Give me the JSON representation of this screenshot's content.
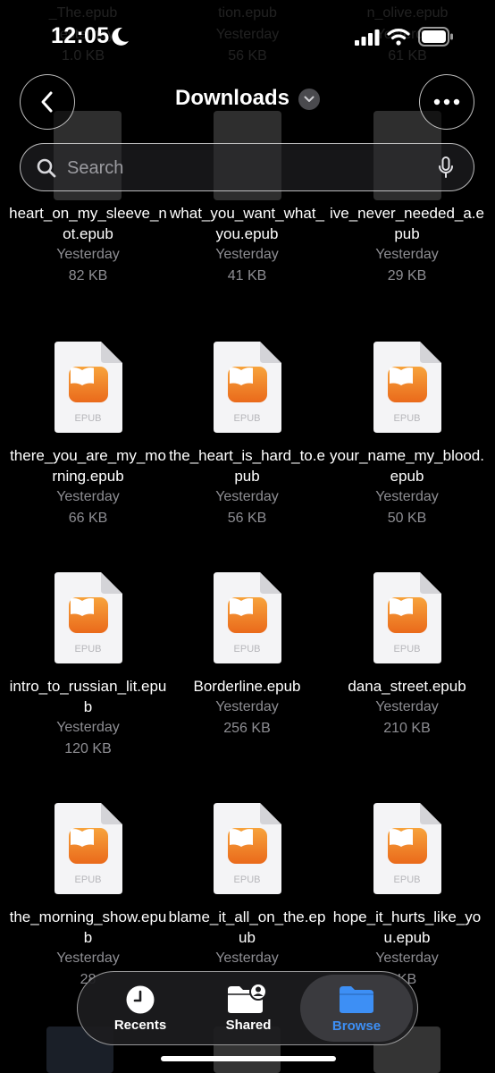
{
  "status_bar": {
    "time": "12:05"
  },
  "header": {
    "title": "Downloads"
  },
  "search": {
    "placeholder": "Search"
  },
  "ghost_items": [
    {
      "name": "_The.epub",
      "date": "Yesterday",
      "size": "1.0 KB"
    },
    {
      "name": "tion.epub",
      "date": "Yesterday",
      "size": "56 KB"
    },
    {
      "name": "n_olive.epub",
      "date": "Yesterday",
      "size": "61 KB"
    }
  ],
  "files": [
    {
      "name": "heart_on_my_sleeve_not.epub",
      "date": "Yesterday",
      "size": "82 KB"
    },
    {
      "name": "what_you_want_what_you.epub",
      "date": "Yesterday",
      "size": "41 KB"
    },
    {
      "name": "ive_never_needed_a.epub",
      "date": "Yesterday",
      "size": "29 KB"
    },
    {
      "name": "there_you_are_my_morning.epub",
      "date": "Yesterday",
      "size": "66 KB",
      "type_label": "EPUB"
    },
    {
      "name": "the_heart_is_hard_to.epub",
      "date": "Yesterday",
      "size": "56 KB",
      "type_label": "EPUB"
    },
    {
      "name": "your_name_my_blood.epub",
      "date": "Yesterday",
      "size": "50 KB",
      "type_label": "EPUB"
    },
    {
      "name": "intro_to_russian_lit.epub",
      "date": "Yesterday",
      "size": "120 KB",
      "type_label": "EPUB"
    },
    {
      "name": "Borderline.epub",
      "date": "Yesterday",
      "size": "256 KB",
      "type_label": "EPUB"
    },
    {
      "name": "dana_street.epub",
      "date": "Yesterday",
      "size": "210 KB",
      "type_label": "EPUB"
    },
    {
      "name": "the_morning_show.epub",
      "date": "Yesterday",
      "size": "28",
      "type_label": "EPUB"
    },
    {
      "name": "blame_it_all_on_the.epub",
      "date": "Yesterday",
      "size": "",
      "type_label": "EPUB"
    },
    {
      "name": "hope_it_hurts_like_you.epub",
      "date": "Yesterday",
      "size": "KB",
      "type_label": "EPUB"
    }
  ],
  "tabs": [
    {
      "label": "Recents",
      "icon": "clock-icon"
    },
    {
      "label": "Shared",
      "icon": "shared-folder-icon"
    },
    {
      "label": "Browse",
      "icon": "folder-icon",
      "selected": true
    }
  ],
  "colors": {
    "accent": "#3d8ff5",
    "book_badge": "#f08a2c",
    "secondary_text": "#8e8e93"
  }
}
